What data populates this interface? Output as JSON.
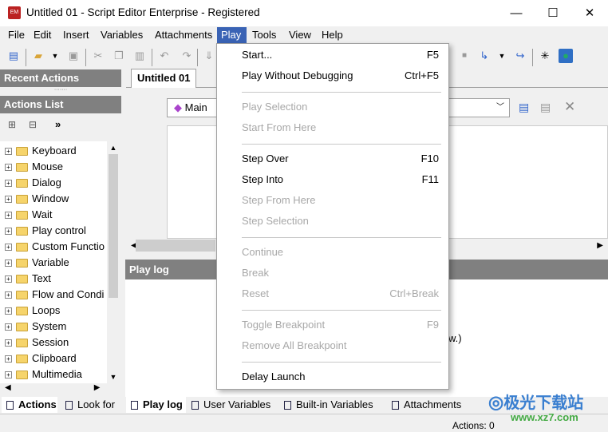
{
  "window": {
    "title": "Untitled 01 - Script Editor  Enterprise - Registered",
    "minimize": "—",
    "maximize": "☐",
    "close": "✕"
  },
  "menubar": [
    "File",
    "Edit",
    "Insert",
    "Variables",
    "Attachments",
    "Play",
    "Tools",
    "View",
    "Help"
  ],
  "left_panel": {
    "recent_actions": "Recent Actions",
    "actions_list": "Actions List",
    "tree": [
      "Keyboard",
      "Mouse",
      "Dialog",
      "Window",
      "Wait",
      "Play control",
      "Custom Functio",
      "Variable",
      "Text",
      "Flow and Condi",
      "Loops",
      "System",
      "Session",
      "Clipboard",
      "Multimedia"
    ],
    "tabs": [
      "Actions",
      "Look for"
    ]
  },
  "editor": {
    "tab": "Untitled 01",
    "function_select": "Main"
  },
  "play_log": {
    "title": "Play log",
    "partial_text": "w.)"
  },
  "bottom_tabs": [
    "Play log",
    "User Variables",
    "Built-in Variables",
    "Attachments"
  ],
  "status": {
    "actions": "Actions: 0"
  },
  "play_menu": {
    "items": [
      {
        "label": "Start...",
        "shortcut": "F5",
        "enabled": true
      },
      {
        "label": "Play Without Debugging",
        "shortcut": "Ctrl+F5",
        "enabled": true
      },
      {
        "label": "Play Selection",
        "shortcut": "",
        "enabled": false
      },
      {
        "label": "Start From Here",
        "shortcut": "",
        "enabled": false
      },
      {
        "label": "Step Over",
        "shortcut": "F10",
        "enabled": true
      },
      {
        "label": "Step Into",
        "shortcut": "F11",
        "enabled": true
      },
      {
        "label": "Step From Here",
        "shortcut": "",
        "enabled": false
      },
      {
        "label": "Step Selection",
        "shortcut": "",
        "enabled": false
      },
      {
        "label": "Continue",
        "shortcut": "",
        "enabled": false
      },
      {
        "label": "Break",
        "shortcut": "",
        "enabled": false
      },
      {
        "label": "Reset",
        "shortcut": "Ctrl+Break",
        "enabled": false
      },
      {
        "label": "Toggle Breakpoint",
        "shortcut": "F9",
        "enabled": false
      },
      {
        "label": "Remove All Breakpoint",
        "shortcut": "",
        "enabled": false
      },
      {
        "label": "Delay Launch",
        "shortcut": "",
        "enabled": true
      }
    ]
  },
  "watermark": {
    "text": "极光下载站",
    "url": "www.xz7.com"
  },
  "colors": {
    "menu_active": "#3a63b5",
    "panel_header": "#808080"
  }
}
